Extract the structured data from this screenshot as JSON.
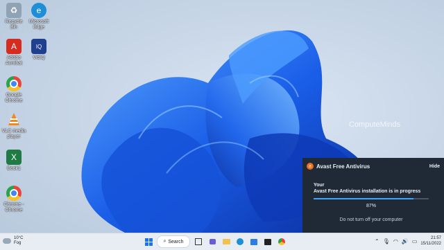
{
  "desktop": {
    "icons": [
      {
        "label": "Recycle Bin",
        "icon": "recycle-bin-icon",
        "color": "#8fa3b5"
      },
      {
        "label": "Microsoft Edge",
        "icon": "edge-icon",
        "color": "#1e8fd6"
      },
      {
        "label": "Adobe Acrobat",
        "icon": "acrobat-icon",
        "color": "#d62b1f"
      },
      {
        "label": "VidIQ",
        "icon": "vidiq-icon",
        "color": "#1f3f8f"
      },
      {
        "label": "Google Chrome",
        "icon": "chrome-icon",
        "color": "#e8453c"
      },
      {
        "label": "VLC media player",
        "icon": "vlc-icon",
        "color": "#f08a1c"
      },
      {
        "label": "Book1",
        "icon": "excel-icon",
        "color": "#1f7a44"
      },
      {
        "label": "Chrome - Chrome",
        "icon": "chrome-icon",
        "color": "#e8453c"
      }
    ],
    "watermark": "ComputeMinds"
  },
  "notification": {
    "app_name": "Avast Free Antivirus",
    "hide_label": "Hide",
    "line1": "Your",
    "line2": "Avast Free Antivirus installation is in progress",
    "progress_value": 0.87,
    "progress_text": "87%",
    "note": "Do not turn off your computer",
    "accent_color": "#f26a1b",
    "progress_color": "#3ea6ff"
  },
  "taskbar": {
    "weather_temp": "10°C",
    "weather_desc": "Fog",
    "search_label": "Search",
    "time": "21:57",
    "date": "15/11/2022"
  }
}
